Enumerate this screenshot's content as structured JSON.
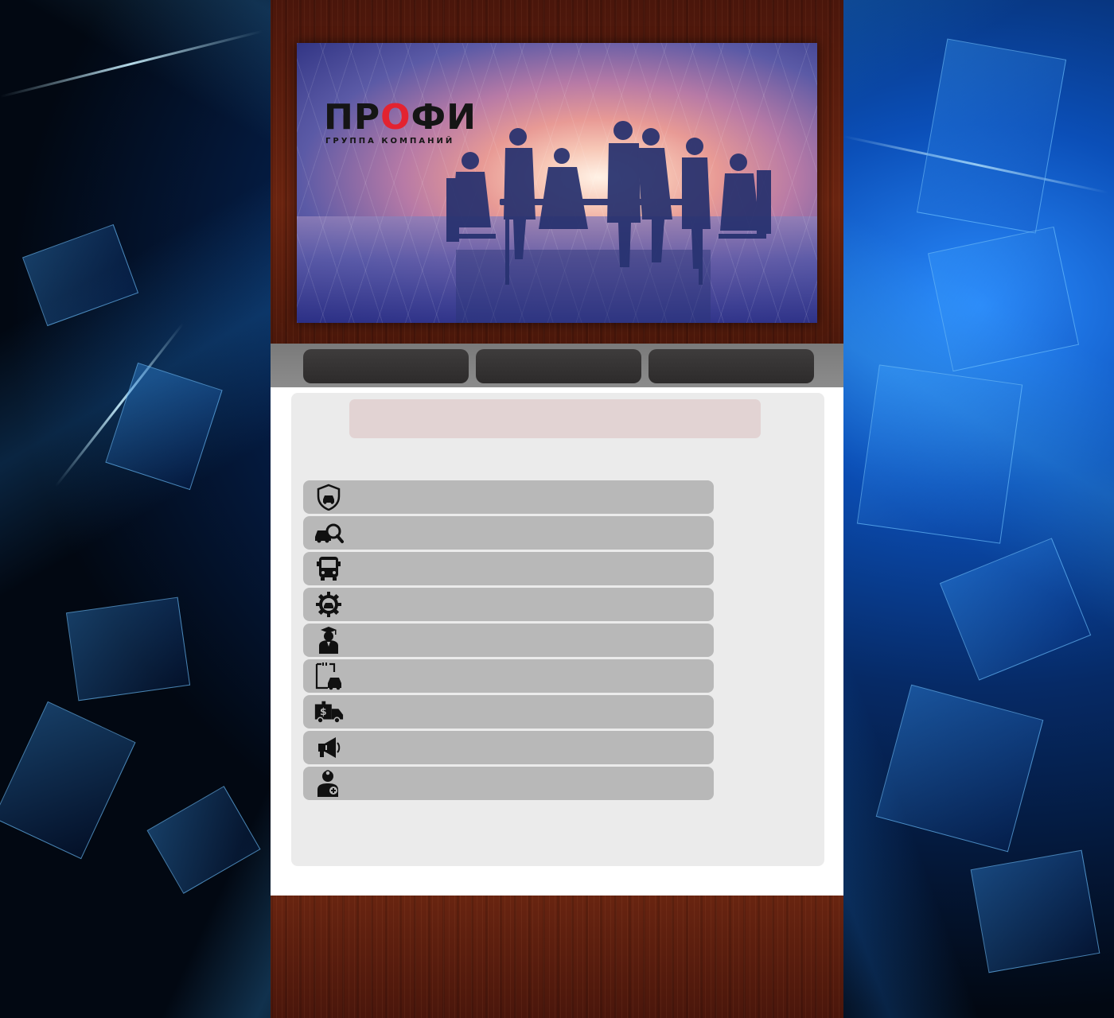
{
  "brand": {
    "logo_pre": "ПР",
    "logo_accent": "О",
    "logo_post": "ФИ",
    "logo_sub": "ГРУППА КОМПАНИЙ",
    "accent_color": "#e32330"
  },
  "nav": {
    "buttons": [
      {
        "label": ""
      },
      {
        "label": ""
      },
      {
        "label": ""
      }
    ]
  },
  "main": {
    "title": ""
  },
  "services": [
    {
      "icon": "car-shield-icon",
      "label": ""
    },
    {
      "icon": "car-search-icon",
      "label": ""
    },
    {
      "icon": "bus-icon",
      "label": ""
    },
    {
      "icon": "car-gear-icon",
      "label": ""
    },
    {
      "icon": "graduate-icon",
      "label": ""
    },
    {
      "icon": "clipboard-car-icon",
      "label": ""
    },
    {
      "icon": "cash-van-icon",
      "label": ""
    },
    {
      "icon": "megaphone-icon",
      "label": ""
    },
    {
      "icon": "doctor-icon",
      "label": ""
    }
  ]
}
